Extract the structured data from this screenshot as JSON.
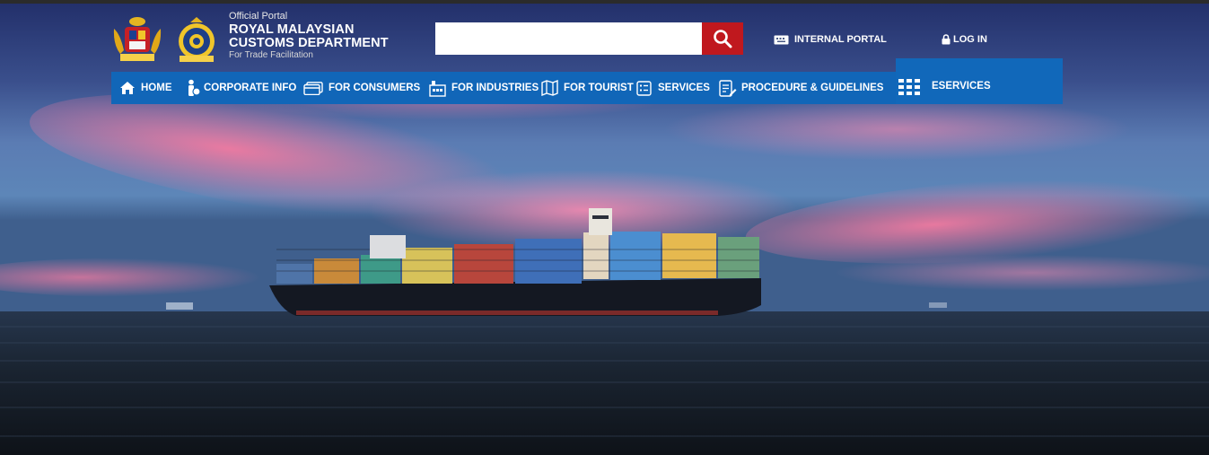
{
  "header": {
    "small_title": "Official Portal",
    "title_line1": "ROYAL MALAYSIAN",
    "title_line2": "CUSTOMS DEPARTMENT",
    "tagline": "For Trade Facilitation"
  },
  "search": {
    "value": "",
    "placeholder": "",
    "button_icon": "search-icon"
  },
  "top_links": {
    "internal_portal": "INTERNAL PORTAL",
    "login": "LOG IN"
  },
  "nav": {
    "items": [
      {
        "label": "HOME",
        "icon": "home-icon"
      },
      {
        "label": "CORPORATE INFO",
        "icon": "info-person-icon"
      },
      {
        "label": "FOR CONSUMERS",
        "icon": "card-icon"
      },
      {
        "label": "FOR INDUSTRIES",
        "icon": "factory-icon"
      },
      {
        "label": "FOR TOURIST",
        "icon": "map-icon"
      },
      {
        "label": "SERVICES",
        "icon": "list-icon"
      },
      {
        "label": "PROCEDURE & GUIDELINES",
        "icon": "document-edit-icon"
      }
    ],
    "eservices": {
      "label": "ESERVICES",
      "icon": "grid-icon"
    }
  },
  "colors": {
    "nav_blue": "#1166b8",
    "search_red": "#c0181e",
    "sky_pink": "#ec6f98",
    "sea_dark": "#1b2533"
  }
}
